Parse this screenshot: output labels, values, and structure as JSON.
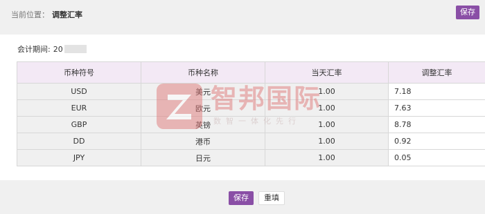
{
  "header": {
    "location_prefix": "当前位置：",
    "page_title": "调整汇率",
    "save_label": "保存"
  },
  "period": {
    "label": "会计期间:",
    "value": "20"
  },
  "table": {
    "headers": [
      "币种符号",
      "币种名称",
      "当天汇率",
      "调整汇率"
    ],
    "rows": [
      {
        "code": "USD",
        "name": "美元",
        "today": "1.00",
        "adjusted": "7.18"
      },
      {
        "code": "EUR",
        "name": "欧元",
        "today": "1.00",
        "adjusted": "7.63"
      },
      {
        "code": "GBP",
        "name": "英镑",
        "today": "1.00",
        "adjusted": "8.78"
      },
      {
        "code": "DD",
        "name": "港币",
        "today": "1.00",
        "adjusted": "0.92"
      },
      {
        "code": "JPY",
        "name": "日元",
        "today": "1.00",
        "adjusted": "0.05"
      }
    ]
  },
  "footer": {
    "save_label": "保存",
    "reset_label": "重填"
  },
  "watermark": {
    "brand": "智邦国际",
    "slogan": "数智一体化先行"
  },
  "colors": {
    "accent": "#8a4fa6",
    "header_row": "#f3e9f5",
    "panel": "#f0f0f0"
  }
}
